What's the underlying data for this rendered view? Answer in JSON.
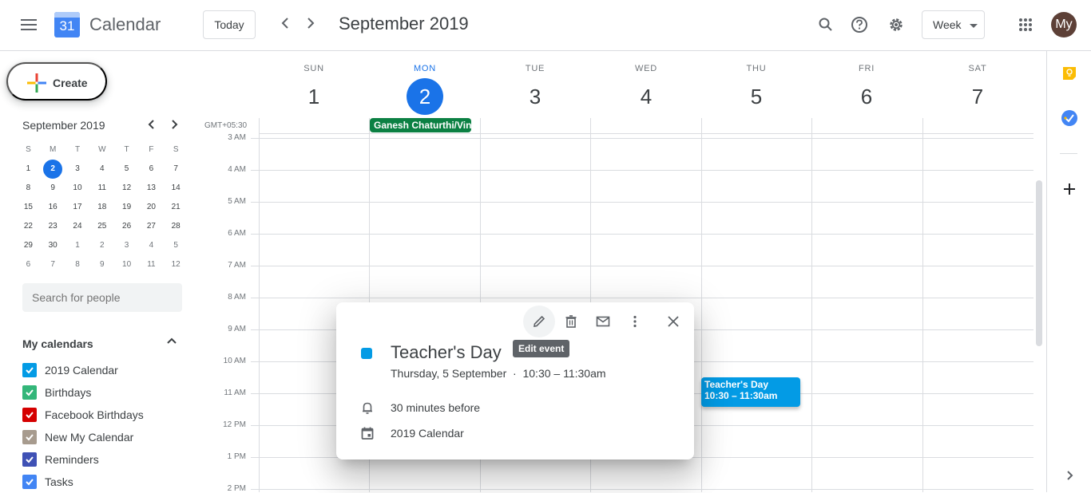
{
  "header": {
    "app_title": "Calendar",
    "logo_text": "31",
    "today_label": "Today",
    "prev_label": "‹",
    "next_label": "›",
    "month_title": "September 2019",
    "view_label": "Week",
    "avatar_text": "My"
  },
  "sidebar": {
    "create_label": "Create",
    "mini_calendar": {
      "title": "September 2019",
      "weekdays": [
        "S",
        "M",
        "T",
        "W",
        "T",
        "F",
        "S"
      ],
      "weeks": [
        [
          "1",
          "2",
          "3",
          "4",
          "5",
          "6",
          "7"
        ],
        [
          "8",
          "9",
          "10",
          "11",
          "12",
          "13",
          "14"
        ],
        [
          "15",
          "16",
          "17",
          "18",
          "19",
          "20",
          "21"
        ],
        [
          "22",
          "23",
          "24",
          "25",
          "26",
          "27",
          "28"
        ],
        [
          "29",
          "30",
          "1",
          "2",
          "3",
          "4",
          "5"
        ],
        [
          "6",
          "7",
          "8",
          "9",
          "10",
          "11",
          "12"
        ]
      ],
      "today": "2"
    },
    "search_placeholder": "Search for people",
    "my_calendars_title": "My calendars",
    "calendars": [
      {
        "label": "2019 Calendar",
        "color": "#039be5"
      },
      {
        "label": "Birthdays",
        "color": "#33b679"
      },
      {
        "label": "Facebook Birthdays",
        "color": "#d50000"
      },
      {
        "label": "New My Calendar",
        "color": "#a79b8e"
      },
      {
        "label": "Reminders",
        "color": "#3f51b5"
      },
      {
        "label": "Tasks",
        "color": "#4285f4"
      }
    ]
  },
  "week": {
    "timezone": "GMT+05:30",
    "days": [
      {
        "name": "SUN",
        "num": "1"
      },
      {
        "name": "MON",
        "num": "2",
        "active": true
      },
      {
        "name": "TUE",
        "num": "3"
      },
      {
        "name": "WED",
        "num": "4"
      },
      {
        "name": "THU",
        "num": "5"
      },
      {
        "name": "FRI",
        "num": "6"
      },
      {
        "name": "SAT",
        "num": "7"
      }
    ],
    "hours": [
      "3 AM",
      "4 AM",
      "5 AM",
      "6 AM",
      "7 AM",
      "8 AM",
      "9 AM",
      "10 AM",
      "11 AM",
      "12 PM",
      "1 PM",
      "2 PM"
    ],
    "all_day_event": {
      "title": "Ganesh Chaturthi/Vin",
      "color": "#0b8043"
    },
    "event": {
      "title": "Teacher's Day",
      "time": "10:30 – 11:30am",
      "color": "#039be5"
    }
  },
  "popup": {
    "tooltip": "Edit event",
    "title": "Teacher's Day",
    "when": "Thursday, 5 September  ·  10:30 – 11:30am",
    "reminder": "30 minutes before",
    "calendar": "2019 Calendar"
  }
}
